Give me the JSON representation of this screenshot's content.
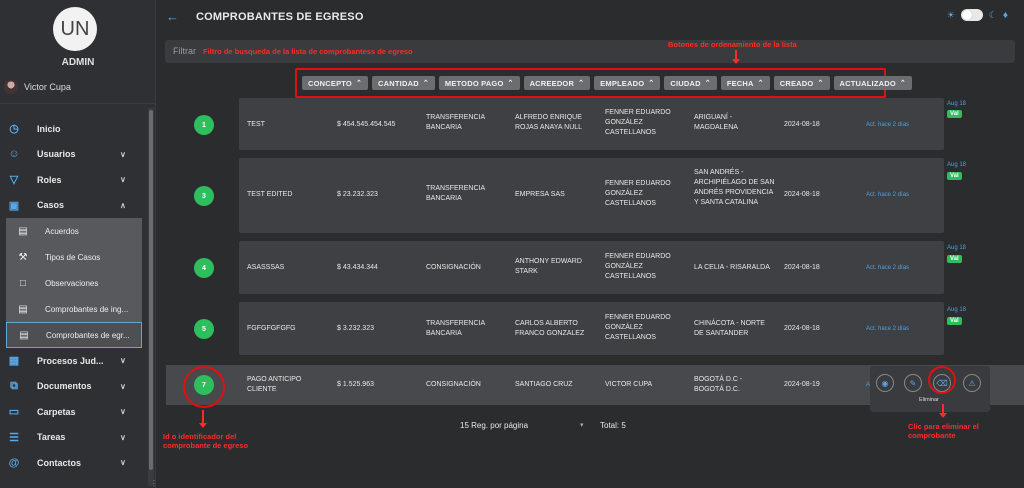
{
  "sidebar": {
    "avatar_initials": "UN",
    "role": "ADMIN",
    "user_name": "Victor Cupa",
    "items": [
      {
        "label": "Inicio",
        "icon": "clock-icon",
        "chev": ""
      },
      {
        "label": "Usuarios",
        "icon": "user-icon",
        "chev": "∨"
      },
      {
        "label": "Roles",
        "icon": "filter-icon",
        "chev": "∨"
      },
      {
        "label": "Casos",
        "icon": "briefcase-icon",
        "chev": "∧"
      }
    ],
    "subitems": [
      {
        "label": "Acuerdos",
        "icon": "money-icon"
      },
      {
        "label": "Tipos de Casos",
        "icon": "wrench-icon"
      },
      {
        "label": "Observaciones",
        "icon": "comment-icon"
      },
      {
        "label": "Comprobantes de ing...",
        "icon": "receipt-icon"
      },
      {
        "label": "Comprobantes de egr...",
        "icon": "receipt-icon"
      }
    ],
    "items2": [
      {
        "label": "Procesos Jud...",
        "icon": "building-icon",
        "chev": "∨"
      },
      {
        "label": "Documentos",
        "icon": "documents-icon",
        "chev": "∨"
      },
      {
        "label": "Carpetas",
        "icon": "folder-icon",
        "chev": "∨"
      },
      {
        "label": "Tareas",
        "icon": "list-icon",
        "chev": "∨"
      },
      {
        "label": "Contactos",
        "icon": "at-icon",
        "chev": "∨"
      }
    ]
  },
  "header": {
    "title": "COMPROBANTES DE EGRESO"
  },
  "filter": {
    "label": "Filtrar"
  },
  "sort_buttons": [
    "CONCEPTO",
    "CANTIDAD",
    "METODO PAGO",
    "ACREEDOR",
    "EMPLEADO",
    "CIUDAD",
    "FECHA",
    "CREADO",
    "ACTUALIZADO"
  ],
  "rows": [
    {
      "id": "1",
      "concepto": "TEST",
      "cantidad": "$ 454.545.454.545",
      "metodo": "TRANSFERENCIA BANCARIA",
      "acreedor": "ALFREDO ENRIQUE ROJAS ANAYA NULL",
      "empleado": "FENNER EDUARDO GONZÁLEZ CASTELLANOS",
      "ciudad": "ARIGUANÍ - MAGDALENA",
      "fecha": "2024-08-18",
      "act": "Act. hace 2 días",
      "side_date": "Aug 18",
      "badge": "Val"
    },
    {
      "id": "3",
      "concepto": "TEST EDITED",
      "cantidad": "$ 23.232.323",
      "metodo": "TRANSFERENCIA BANCARIA",
      "acreedor": "EMPRESA SAS",
      "empleado": "FENNER EDUARDO GONZÁLEZ CASTELLANOS",
      "ciudad": "SAN ANDRÉS - ARCHIPIÉLAGO DE SAN ANDRÉS PROVIDENCIA Y SANTA CATALINA",
      "fecha": "2024-08-18",
      "act": "Act. hace 2 días",
      "side_date": "Aug 18",
      "badge": "Val"
    },
    {
      "id": "4",
      "concepto": "ASASSSAS",
      "cantidad": "$ 43.434.344",
      "metodo": "CONSIGNACIÓN",
      "acreedor": "ANTHONY EDWARD STARK",
      "empleado": "FENNER EDUARDO GONZÁLEZ CASTELLANOS",
      "ciudad": "LA CELIA - RISARALDA",
      "fecha": "2024-08-18",
      "act": "Act. hace 2 días",
      "side_date": "Aug 18",
      "badge": "Val"
    },
    {
      "id": "5",
      "concepto": "FGFGFGFGFG",
      "cantidad": "$ 3.232.323",
      "metodo": "TRANSFERENCIA BANCARIA",
      "acreedor": "CARLOS ALBERTO FRANCO GONZALEZ",
      "empleado": "FENNER EDUARDO GONZÁLEZ CASTELLANOS",
      "ciudad": "CHINÁCOTA - NORTE DE SANTANDER",
      "fecha": "2024-08-18",
      "act": "Act. hace 2 días",
      "side_date": "Aug 18",
      "badge": "Val"
    },
    {
      "id": "7",
      "concepto": "PAGO ANTICIPO CLIENTE",
      "cantidad": "$ 1.525.963",
      "metodo": "CONSIGNACIÓN",
      "acreedor": "SANTIAGO CRUZ",
      "empleado": "VICTOR CUPA",
      "ciudad": "BOGOTÁ D.C - BOGOTÁ D.C.",
      "fecha": "2024-08-19",
      "act": "A",
      "side_date": "",
      "badge": ""
    }
  ],
  "actions": {
    "delete_label": "Eliminar"
  },
  "pagination": {
    "per_page": "15 Reg. por página",
    "total": "Total: 5"
  },
  "annotations": {
    "filter_note": "Filtro de busqueda de la lista de comprobantess de egreso",
    "sort_note": "Botones de ordenamiento de la lista",
    "id_note_1": "Id o identificador del",
    "id_note_2": "comprobante de egreso",
    "delete_note_1": "Clic para eliminar el",
    "delete_note_2": "comprobante"
  },
  "colors": {
    "accent": "#4ea1e0",
    "success": "#2fbe5d",
    "annotation": "#ff2a2a"
  }
}
